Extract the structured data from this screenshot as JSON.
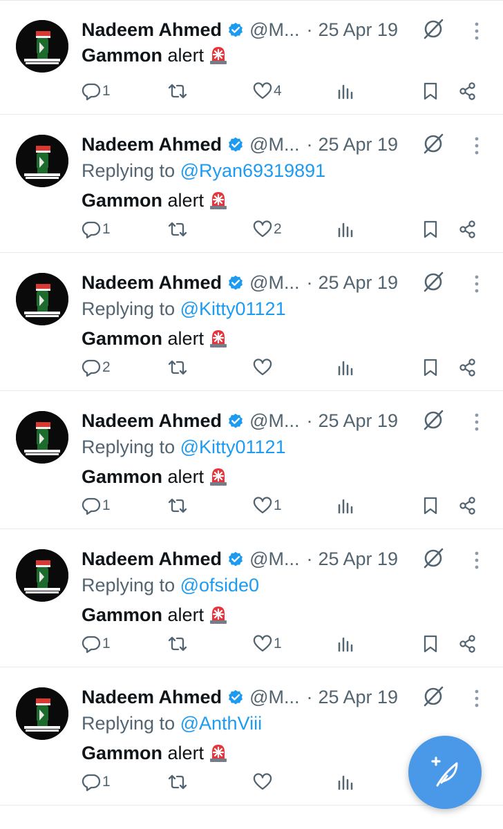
{
  "colors": {
    "accent": "#1d9bf0",
    "muted": "#536471",
    "fab": "#4a99e9"
  },
  "icons": [
    "avatar-fist",
    "verified-badge",
    "grok-icon",
    "more-icon",
    "reply-icon",
    "retweet-icon",
    "like-icon",
    "views-icon",
    "bookmark-icon",
    "share-icon",
    "compose-icon",
    "siren-emoji"
  ],
  "tweets": [
    {
      "name": "Nadeem Ahmed",
      "handle": "@M...",
      "sep": "·",
      "date": "25 Apr 19",
      "replying_prefix": "",
      "replying_to": "",
      "text_bold": "Gammon",
      "text_rest": " alert",
      "replies": "1",
      "retweets": "",
      "likes": "4"
    },
    {
      "name": "Nadeem Ahmed",
      "handle": "@M...",
      "sep": "·",
      "date": "25 Apr 19",
      "replying_prefix": "Replying to ",
      "replying_to": "@Ryan69319891",
      "text_bold": "Gammon",
      "text_rest": " alert",
      "replies": "1",
      "retweets": "",
      "likes": "2"
    },
    {
      "name": "Nadeem Ahmed",
      "handle": "@M...",
      "sep": "·",
      "date": "25 Apr 19",
      "replying_prefix": "Replying to ",
      "replying_to": "@Kitty01121",
      "text_bold": "Gammon",
      "text_rest": " alert",
      "replies": "2",
      "retweets": "",
      "likes": ""
    },
    {
      "name": "Nadeem Ahmed",
      "handle": "@M...",
      "sep": "·",
      "date": "25 Apr 19",
      "replying_prefix": "Replying to ",
      "replying_to": "@Kitty01121",
      "text_bold": "Gammon",
      "text_rest": " alert",
      "replies": "1",
      "retweets": "",
      "likes": "1"
    },
    {
      "name": "Nadeem Ahmed",
      "handle": "@M...",
      "sep": "·",
      "date": "25 Apr 19",
      "replying_prefix": "Replying to ",
      "replying_to": "@ofside0",
      "text_bold": "Gammon",
      "text_rest": " alert",
      "replies": "1",
      "retweets": "",
      "likes": "1"
    },
    {
      "name": "Nadeem Ahmed",
      "handle": "@M...",
      "sep": "·",
      "date": "25 Apr 19",
      "replying_prefix": "Replying to ",
      "replying_to": "@AnthViii",
      "text_bold": "Gammon",
      "text_rest": " alert",
      "replies": "1",
      "retweets": "",
      "likes": ""
    }
  ]
}
